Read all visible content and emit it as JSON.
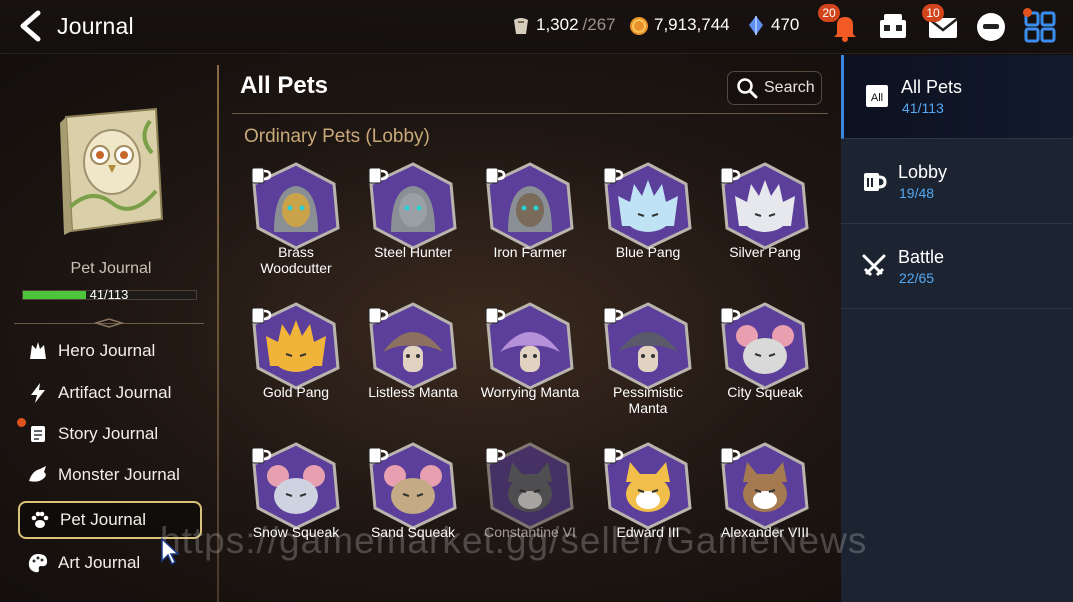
{
  "header": {
    "title": "Journal",
    "stamina": {
      "value": "1,302",
      "max": "/267",
      "icon": "stamina-icon"
    },
    "gold": {
      "value": "7,913,744",
      "icon": "gold-coin-icon"
    },
    "skystone": {
      "value": "470",
      "icon": "skystone-icon"
    },
    "notification_badge": "20",
    "mail_badge": "10"
  },
  "left": {
    "book_label": "Pet Journal",
    "progress_text": "41/113",
    "progress_fraction": 0.363,
    "menu": [
      {
        "label": "Hero Journal",
        "icon": "hero-icon"
      },
      {
        "label": "Artifact Journal",
        "icon": "lightning-icon"
      },
      {
        "label": "Story Journal",
        "icon": "scroll-icon"
      },
      {
        "label": "Monster Journal",
        "icon": "dragon-icon"
      },
      {
        "label": "Pet Journal",
        "icon": "paw-icon"
      },
      {
        "label": "Art Journal",
        "icon": "palette-icon"
      }
    ]
  },
  "main": {
    "title": "All Pets",
    "search_label": "Search",
    "section_label": "Ordinary Pets (Lobby)",
    "pets": [
      {
        "name": "Brass Woodcutter",
        "color": "#c9a24a",
        "kind": "robot"
      },
      {
        "name": "Steel Hunter",
        "color": "#9aa0a6",
        "kind": "robot"
      },
      {
        "name": "Iron Farmer",
        "color": "#7a6a5a",
        "kind": "robot"
      },
      {
        "name": "Blue Pang",
        "color": "#bfe2f5",
        "kind": "pang"
      },
      {
        "name": "Silver Pang",
        "color": "#e6e8ee",
        "kind": "pang"
      },
      {
        "name": "Gold Pang",
        "color": "#f0b43a",
        "kind": "pang"
      },
      {
        "name": "Listless Manta",
        "color": "#8c7060",
        "kind": "manta"
      },
      {
        "name": "Worrying Manta",
        "color": "#b690d8",
        "kind": "manta"
      },
      {
        "name": "Pessimistic Manta",
        "color": "#5a5a6a",
        "kind": "manta"
      },
      {
        "name": "City Squeak",
        "color": "#d9d9d9",
        "kind": "squeak"
      },
      {
        "name": "Snow Squeak",
        "color": "#cfd2e0",
        "kind": "squeak"
      },
      {
        "name": "Sand Squeak",
        "color": "#c4aa85",
        "kind": "squeak"
      },
      {
        "name": "Constantine VI",
        "color": "#6a7078",
        "kind": "cat"
      },
      {
        "name": "Edward III",
        "color": "#f2c04a",
        "kind": "cat"
      },
      {
        "name": "Alexander VIII",
        "color": "#a57a50",
        "kind": "cat"
      }
    ]
  },
  "right": {
    "categories": [
      {
        "name": "All Pets",
        "count": "41/113",
        "icon": "all-icon"
      },
      {
        "name": "Lobby",
        "count": "19/48",
        "icon": "mug-icon"
      },
      {
        "name": "Battle",
        "count": "22/65",
        "icon": "swords-icon"
      }
    ]
  },
  "watermark": "https://gamemarket.gg/seller/GameNews",
  "colors": {
    "accent_blue": "#3a86e0",
    "progress_green": "#4ec43d",
    "badge_red": "#d2451c",
    "hex_purple": "#5b3f9a"
  }
}
